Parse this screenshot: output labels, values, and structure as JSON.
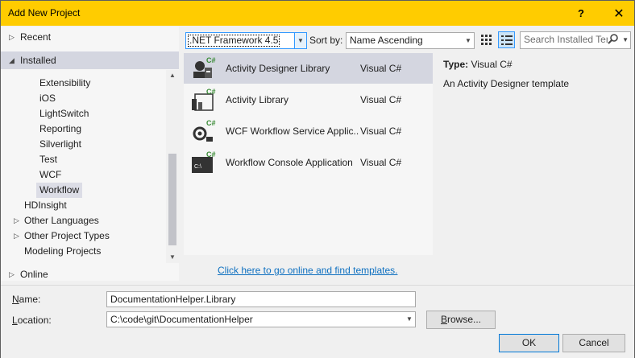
{
  "window": {
    "title": "Add New Project",
    "help": "?",
    "close": "✕"
  },
  "left": {
    "recent": "Recent",
    "installed": "Installed",
    "tree": [
      "Extensibility",
      "iOS",
      "LightSwitch",
      "Reporting",
      "Silverlight",
      "Test",
      "WCF",
      "Workflow"
    ],
    "groups": [
      {
        "label": "HDInsight",
        "expandable": false
      },
      {
        "label": "Other Languages",
        "expandable": true
      },
      {
        "label": "Other Project Types",
        "expandable": true
      },
      {
        "label": "Modeling Projects",
        "expandable": false
      }
    ],
    "online": "Online"
  },
  "toolbar": {
    "framework": ".NET Framework 4.5",
    "sort_label": "Sort by:",
    "sort_value": "Name Ascending",
    "search_placeholder": "Search Installed Ter",
    "search_icon": "search-icon"
  },
  "templates": [
    {
      "name": "Activity Designer Library",
      "lang": "Visual C#",
      "icon": "activity-designer-icon",
      "selected": true
    },
    {
      "name": "Activity Library",
      "lang": "Visual C#",
      "icon": "activity-library-icon",
      "selected": false
    },
    {
      "name": "WCF Workflow Service Applic...",
      "lang": "Visual C#",
      "icon": "wcf-workflow-icon",
      "selected": false
    },
    {
      "name": "Workflow Console Application",
      "lang": "Visual C#",
      "icon": "console-app-icon",
      "selected": false
    }
  ],
  "online_link": "Click here to go online and find templates.",
  "info": {
    "type_label": "Type:",
    "type_value": "Visual C#",
    "description": "An Activity Designer template"
  },
  "form": {
    "name_label_pre": "",
    "name_label_u": "N",
    "name_label_post": "ame:",
    "name_value": "DocumentationHelper.Library",
    "location_label_pre": "",
    "location_label_u": "L",
    "location_label_post": "ocation:",
    "location_value": "C:\\code\\git\\DocumentationHelper",
    "browse_pre": "",
    "browse_u": "B",
    "browse_post": "rowse...",
    "ok": "OK",
    "cancel": "Cancel"
  },
  "colors": {
    "titlebar": "#ffcc00",
    "selection": "#d4d6e0",
    "link": "#0e70c0",
    "accent": "#3399ff"
  }
}
